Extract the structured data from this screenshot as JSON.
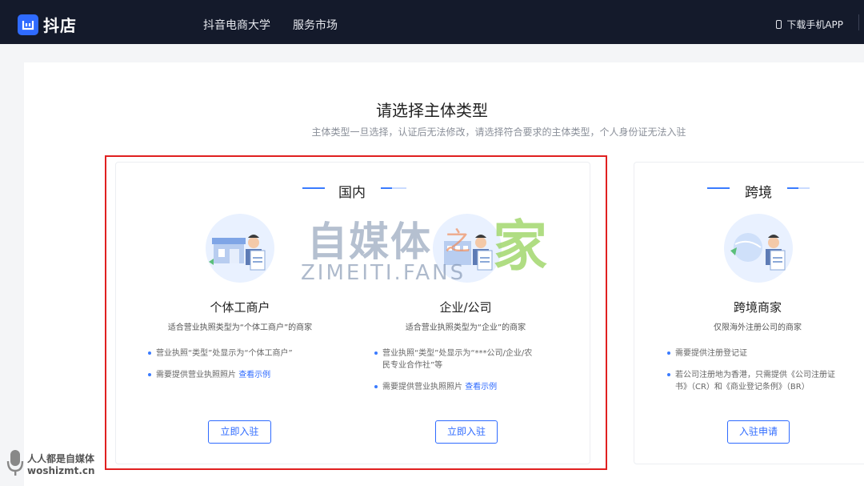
{
  "header": {
    "logo_text": "抖店",
    "nav": [
      "抖音电商大学",
      "服务市场"
    ],
    "download_app": "下载手机APP"
  },
  "page": {
    "title": "请选择主体类型",
    "subtitle": "主体类型一旦选择，认证后无法修改，请选择符合要求的主体类型，个人身份证无法入驻"
  },
  "domestic": {
    "section_title": "国内",
    "types": [
      {
        "name": "个体工商户",
        "desc": "适合营业执照类型为“个体工商户”的商家",
        "bullets": [
          "营业执照“类型”处显示为“个体工商户”",
          "需要提供营业执照照片"
        ],
        "link": "查看示例",
        "button": "立即入驻"
      },
      {
        "name": "企业/公司",
        "desc": "适合营业执照类型为“企业”的商家",
        "bullets": [
          "营业执照“类型”处显示为“***公司/企业/农",
          "民专业合作社”等",
          "需要提供营业执照照片"
        ],
        "link": "查看示例",
        "button": "立即入驻"
      }
    ]
  },
  "cross_border": {
    "section_title": "跨境",
    "type": {
      "name": "跨境商家",
      "desc": "仅限海外注册公司的商家",
      "bullets": [
        "需要提供注册登记证",
        "若公司注册地为香港，只需提供《公司注册证",
        "书》（CR）和《商业登记条例》（BR）"
      ],
      "button": "入驻申请"
    }
  },
  "watermark": {
    "big": "自媒体",
    "zhi": "之",
    "jia": "家",
    "en": "ZIMEITI.FANS",
    "corner_cn": "人人都是自媒体",
    "corner_en": "woshizmt.cn"
  },
  "colors": {
    "accent": "#2f6bff",
    "highlight": "#e02020",
    "topbar": "#141a2b"
  }
}
